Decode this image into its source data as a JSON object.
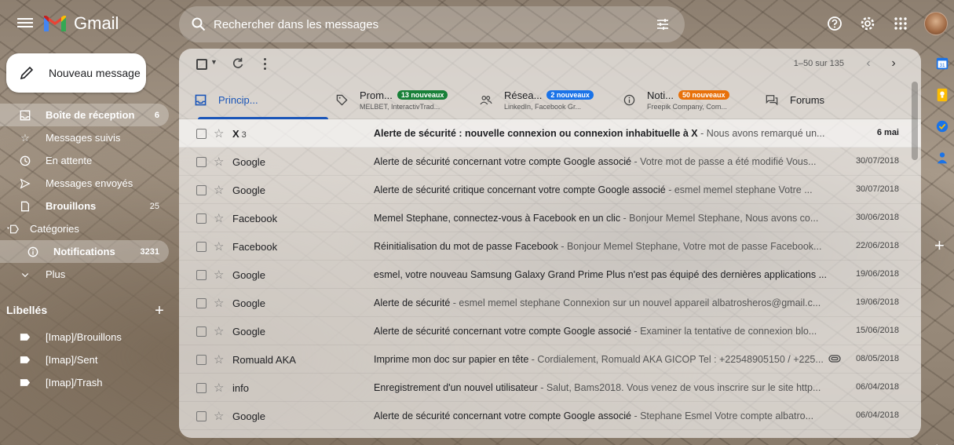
{
  "app": {
    "name": "Gmail"
  },
  "search": {
    "placeholder": "Rechercher dans les messages"
  },
  "compose": {
    "label": "Nouveau message"
  },
  "nav": [
    {
      "label": "Boîte de réception",
      "count": "6",
      "icon": "inbox-icon"
    },
    {
      "label": "Messages suivis",
      "count": "",
      "icon": "star-icon"
    },
    {
      "label": "En attente",
      "count": "",
      "icon": "clock-icon"
    },
    {
      "label": "Messages envoyés",
      "count": "",
      "icon": "send-icon"
    },
    {
      "label": "Brouillons",
      "count": "25",
      "icon": "draft-icon"
    },
    {
      "label": "Catégories",
      "count": "",
      "icon": "label-outline-icon"
    },
    {
      "label": "Notifications",
      "count": "3231",
      "icon": "info-icon"
    },
    {
      "label": "Plus",
      "count": "",
      "icon": "chevron-down-icon"
    }
  ],
  "labels": {
    "title": "Libellés",
    "items": [
      {
        "label": "[Imap]/Brouillons"
      },
      {
        "label": "[Imap]/Sent"
      },
      {
        "label": "[Imap]/Trash"
      }
    ]
  },
  "toolbar": {
    "range": "1–50 sur 135",
    "prev": "‹",
    "next": "›"
  },
  "tabs": [
    {
      "title": "Princip...",
      "badge": "",
      "sub": "",
      "icon": "inbox-icon"
    },
    {
      "title": "Prom...",
      "badge": "13 nouveaux",
      "badge_color": "#188038",
      "sub": "MELBET, InteractivTrad...",
      "icon": "tag-icon"
    },
    {
      "title": "Résea...",
      "badge": "2 nouveaux",
      "badge_color": "#1a73e8",
      "sub": "LinkedIn, Facebook Gr...",
      "icon": "people-icon"
    },
    {
      "title": "Noti...",
      "badge": "50 nouveaux",
      "badge_color": "#e8710a",
      "sub": "Freepik Company, Com...",
      "icon": "info-icon"
    },
    {
      "title": "Forums",
      "badge": "",
      "sub": "",
      "icon": "forum-icon"
    }
  ],
  "emails": [
    {
      "sender": "X",
      "count": "3",
      "subject": "Alerte de sécurité : nouvelle connexion ou connexion inhabituelle à X",
      "snippet": " - Nous avons remarqué un...",
      "date": "6 mai",
      "unread": true,
      "attachment": false
    },
    {
      "sender": "Google",
      "count": "",
      "subject": "Alerte de sécurité concernant votre compte Google associé",
      "snippet": " - Votre mot de passe a été modifié Vous...",
      "date": "30/07/2018",
      "unread": false,
      "attachment": false
    },
    {
      "sender": "Google",
      "count": "",
      "subject": "Alerte de sécurité critique concernant votre compte Google associé",
      "snippet": " - esmel memel stephane Votre ...",
      "date": "30/07/2018",
      "unread": false,
      "attachment": false
    },
    {
      "sender": "Facebook",
      "count": "",
      "subject": "Memel Stephane, connectez-vous à Facebook en un clic",
      "snippet": " - Bonjour Memel Stephane, Nous avons co...",
      "date": "30/06/2018",
      "unread": false,
      "attachment": false
    },
    {
      "sender": "Facebook",
      "count": "",
      "subject": "Réinitialisation du mot de passe Facebook",
      "snippet": " - Bonjour Memel Stephane, Votre mot de passe Facebook...",
      "date": "22/06/2018",
      "unread": false,
      "attachment": false
    },
    {
      "sender": "Google",
      "count": "",
      "subject": "esmel, votre nouveau Samsung Galaxy Grand Prime Plus n'est pas équipé des dernières applications ...",
      "snippet": "",
      "date": "19/06/2018",
      "unread": false,
      "attachment": false
    },
    {
      "sender": "Google",
      "count": "",
      "subject": "Alerte de sécurité",
      "snippet": " - esmel memel stephane Connexion sur un nouvel appareil albatrosheros@gmail.c...",
      "date": "19/06/2018",
      "unread": false,
      "attachment": false
    },
    {
      "sender": "Google",
      "count": "",
      "subject": "Alerte de sécurité concernant votre compte Google associé",
      "snippet": " - Examiner la tentative de connexion blo...",
      "date": "15/06/2018",
      "unread": false,
      "attachment": false
    },
    {
      "sender": "Romuald AKA",
      "count": "",
      "subject": "Imprime mon doc sur papier en tête",
      "snippet": " - Cordialement, Romuald AKA GICOP Tel : +22548905150 / +225...",
      "date": "08/05/2018",
      "unread": false,
      "attachment": true
    },
    {
      "sender": "info",
      "count": "",
      "subject": "Enregistrement d'un nouvel utilisateur",
      "snippet": " - Salut, Bams2018. Vous venez de vous inscrire sur le site http...",
      "date": "06/04/2018",
      "unread": false,
      "attachment": false
    },
    {
      "sender": "Google",
      "count": "",
      "subject": "Alerte de sécurité concernant votre compte Google associé",
      "snippet": " - Stephane Esmel Votre compte albatro...",
      "date": "06/04/2018",
      "unread": false,
      "attachment": false
    }
  ],
  "colors": {
    "accent": "#1a55b8",
    "calendar": "#1a73e8",
    "keep": "#fbbc04",
    "tasks": "#1a73e8",
    "contacts": "#1a73e8"
  }
}
